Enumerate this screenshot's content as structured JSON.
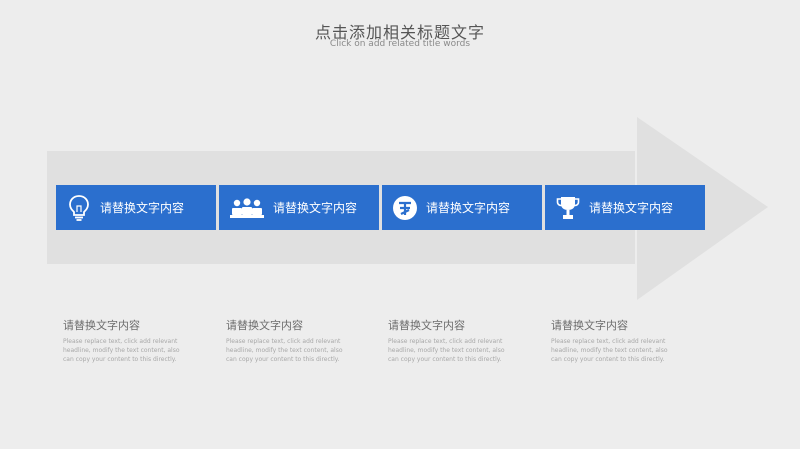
{
  "header": {
    "title": "点击添加相关标题文字",
    "subtitle": "Click on add related title words"
  },
  "steps": [
    {
      "icon": "lightbulb-icon",
      "label": "请替换文字内容"
    },
    {
      "icon": "people-group-icon",
      "label": "请替换文字内容"
    },
    {
      "icon": "badge-letter-icon",
      "label": "请替换文字内容"
    },
    {
      "icon": "trophy-icon",
      "label": "请替换文字内容"
    }
  ],
  "descriptions": [
    {
      "heading": "请替换文字内容",
      "text": "Please replace text, click add relevant headline, modify the text content, also can copy your content to this directly."
    },
    {
      "heading": "请替换文字内容",
      "text": "Please replace text, click add relevant headline, modify the text content, also can copy your content to this directly."
    },
    {
      "heading": "请替换文字内容",
      "text": "Please replace text, click add relevant headline, modify the text content, also can copy your content to this directly."
    },
    {
      "heading": "请替换文字内容",
      "text": "Please replace text, click add relevant headline, modify the text content, also can copy your content to this directly."
    }
  ],
  "colors": {
    "box": "#2b6fce",
    "arrow": "#e0e0e0",
    "background": "#ededed"
  }
}
